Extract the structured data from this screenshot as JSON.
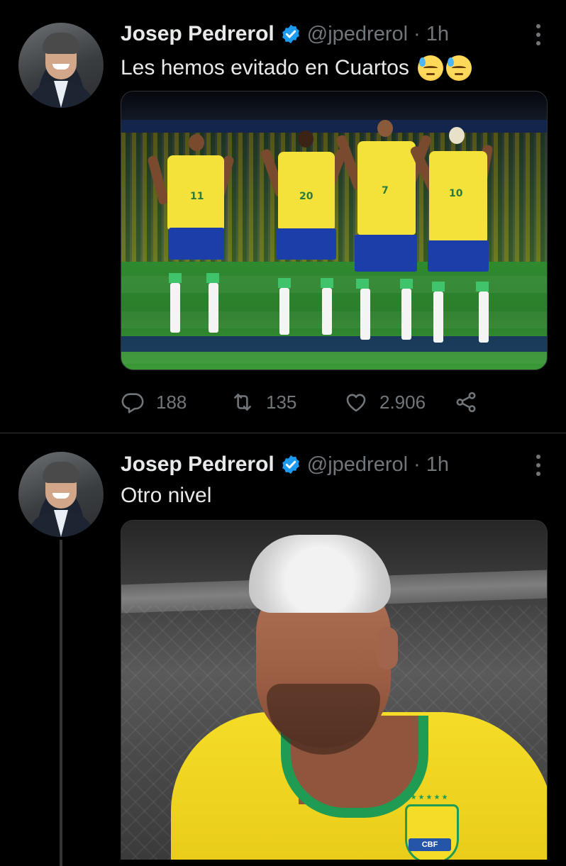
{
  "colors": {
    "background": "#000000",
    "text": "#e7e9ea",
    "muted": "#71767b",
    "verified": "#1d9bf0",
    "divider": "#2f3336"
  },
  "tweets": [
    {
      "author": {
        "name": "Josep Pedrerol",
        "handle": "@jpedrerol",
        "verified_icon": "verified-badge-icon",
        "avatar_icon": "avatar"
      },
      "separator": "·",
      "time": "1h",
      "text": "Les hemos evitado en Cuartos",
      "emojis": [
        "downcast-face-with-sweat-icon",
        "downcast-face-with-sweat-icon"
      ],
      "media": {
        "kind": "photo",
        "subject": "players-dancing-celebration",
        "jersey_numbers": [
          "11",
          "20",
          "7",
          "10"
        ]
      },
      "actions": {
        "replies": "188",
        "retweets": "135",
        "likes": "2.906",
        "icons": [
          "reply-icon",
          "retweet-icon",
          "like-icon",
          "share-icon"
        ]
      }
    },
    {
      "author": {
        "name": "Josep Pedrerol",
        "handle": "@jpedrerol",
        "verified_icon": "verified-badge-icon",
        "avatar_icon": "avatar"
      },
      "separator": "·",
      "time": "1h",
      "text": "Otro nivel",
      "media": {
        "kind": "photo",
        "subject": "player-portrait",
        "crest_text": "CBF",
        "crest_stars": "★★★★★"
      }
    }
  ]
}
